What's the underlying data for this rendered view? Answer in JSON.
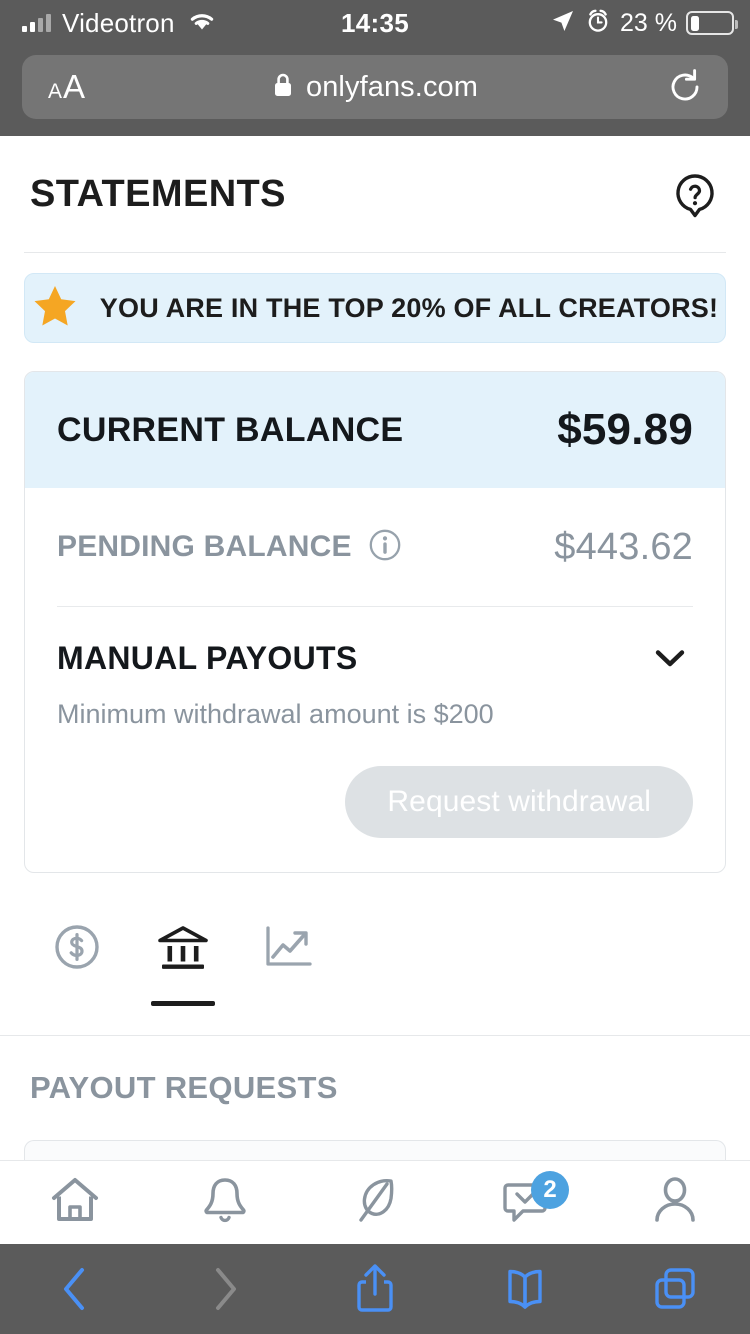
{
  "status_bar": {
    "carrier": "Videotron",
    "time": "14:35",
    "battery_percent": "23 %",
    "icons": [
      "signal-bars-icon",
      "wifi-icon",
      "location-arrow-icon",
      "alarm-clock-icon",
      "battery-icon"
    ]
  },
  "browser": {
    "aa_small": "A",
    "aa_large": "A",
    "url": "onlyfans.com",
    "lock_icon": "lock-icon",
    "reload_icon": "reload-icon",
    "toolbar": {
      "back_label": "Back",
      "forward_label": "Forward",
      "share_label": "Share",
      "bookmarks_label": "Bookmarks",
      "tabs_label": "Tabs"
    },
    "accent_color": "#4a90f5",
    "disabled_color": "#8a8a8a",
    "chrome_color": "#5b5b5b"
  },
  "page": {
    "title": "STATEMENTS",
    "help_icon": "help-question-icon",
    "banner": {
      "icon": "star-icon",
      "text": "YOU ARE IN THE TOP 20% OF ALL CREATORS!",
      "bg_color": "#e3f2fb",
      "star_color": "#f5a623"
    },
    "balance": {
      "current_label": "CURRENT BALANCE",
      "current_value": "$59.89",
      "pending_label": "PENDING BALANCE",
      "pending_info_icon": "info-icon",
      "pending_value": "$443.62",
      "highlight_color": "#e3f2fb"
    },
    "payouts": {
      "title": "MANUAL PAYOUTS",
      "chevron_icon": "chevron-down-icon",
      "note": "Minimum withdrawal amount is $200",
      "request_button_label": "Request withdrawal",
      "request_button_disabled": true
    },
    "tabs": [
      {
        "name": "earnings",
        "icon": "dollar-circle-icon",
        "active": false
      },
      {
        "name": "payouts",
        "icon": "bank-icon",
        "active": true
      },
      {
        "name": "statistics",
        "icon": "trending-up-icon",
        "active": false
      }
    ],
    "payout_requests_title": "PAYOUT REQUESTS"
  },
  "app_nav": [
    {
      "name": "home",
      "icon": "home-icon",
      "badge": null
    },
    {
      "name": "notifications",
      "icon": "bell-icon",
      "badge": null
    },
    {
      "name": "new-post",
      "icon": "feather-icon",
      "badge": null
    },
    {
      "name": "messages",
      "icon": "message-icon",
      "badge": "2"
    },
    {
      "name": "profile",
      "icon": "user-icon",
      "badge": null
    }
  ],
  "colors": {
    "badge_blue": "#4da2e0",
    "muted_grey": "#8a949e",
    "text_dark": "#14181c"
  }
}
